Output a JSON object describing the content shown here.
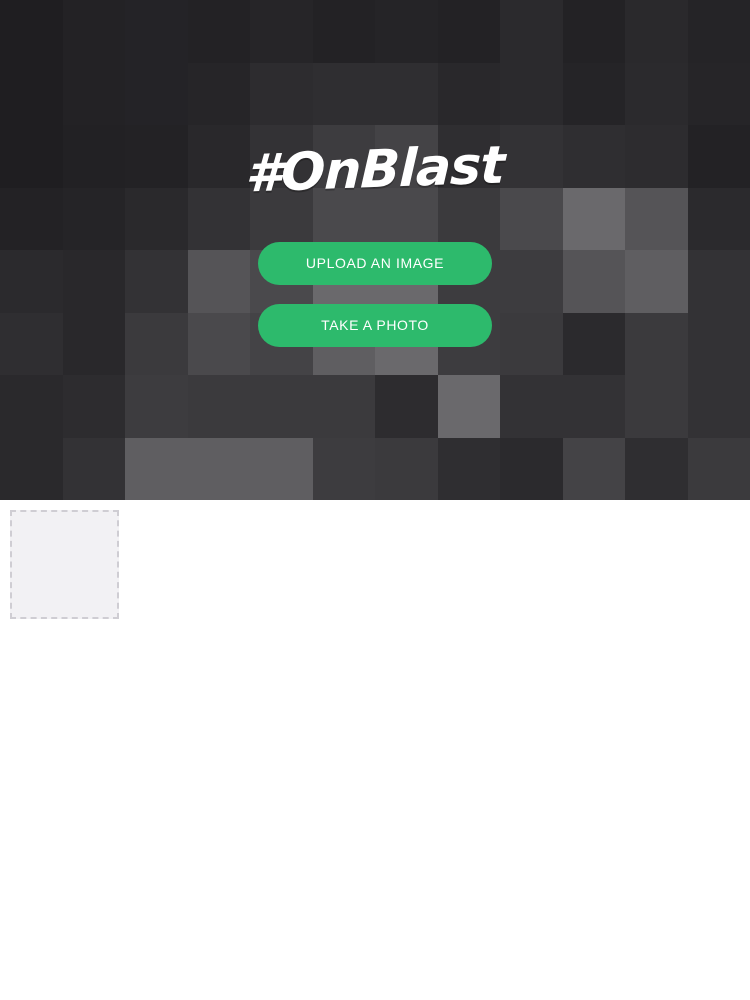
{
  "logo": {
    "text": "#OnBlast"
  },
  "actions": {
    "upload_label": "UPLOAD AN IMAGE",
    "photo_label": "TAKE A PHOTO"
  },
  "colors": {
    "accent_button": "#2dba6c",
    "button_text": "#ffffff",
    "placeholder_fill": "#f2f1f4",
    "placeholder_border": "#cfcdd3",
    "page_background": "#ffffff"
  },
  "icons": {
    "hero_background": "pixelated-mosaic-background",
    "upload_slot": "empty-image-placeholder"
  }
}
